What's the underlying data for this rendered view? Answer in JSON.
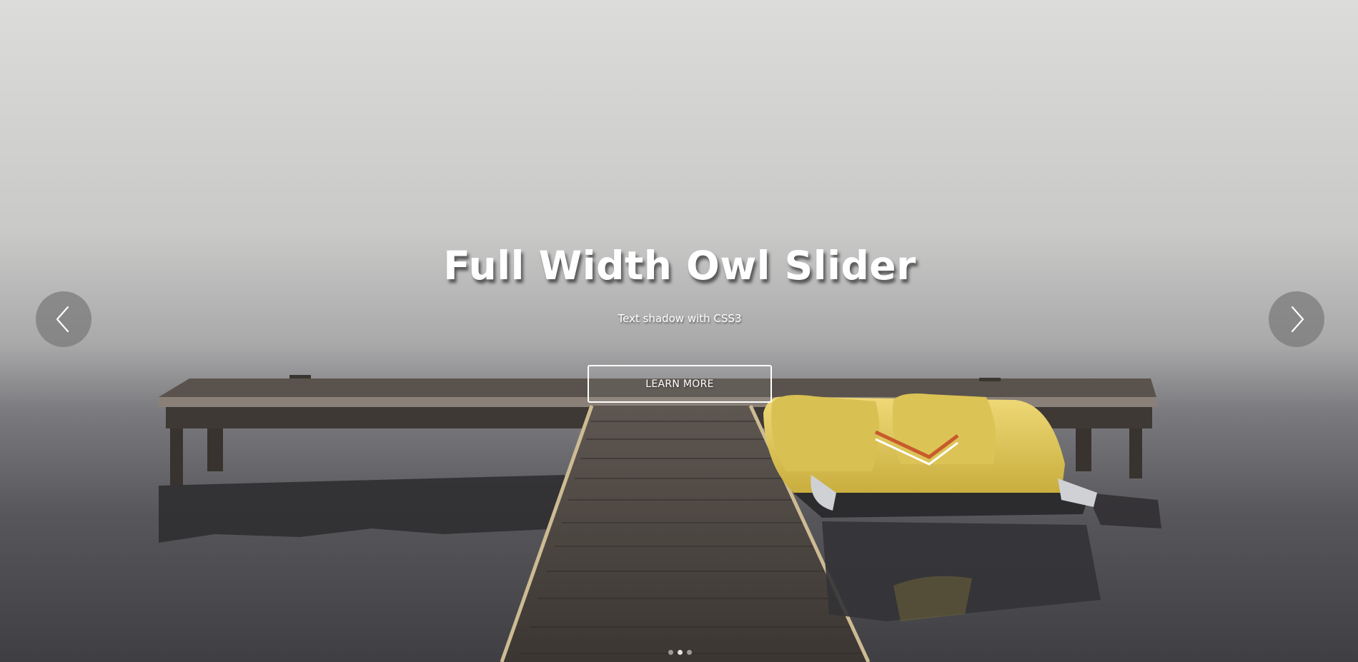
{
  "slide": {
    "headline": "Full Width Owl Slider",
    "subline": "Text shadow with CSS3",
    "cta_label": "LEARN MORE"
  },
  "navigation": {
    "prev_icon": "chevron-left-icon",
    "next_icon": "chevron-right-icon"
  },
  "pagination": {
    "total": 3,
    "active_index": 1
  },
  "colors": {
    "fog_top": "#dcdcda",
    "water": "#4a4a4d",
    "dock": "#4d4640",
    "boat": "#e6cf5c",
    "nav_bg": "#787878",
    "text": "#ffffff"
  }
}
